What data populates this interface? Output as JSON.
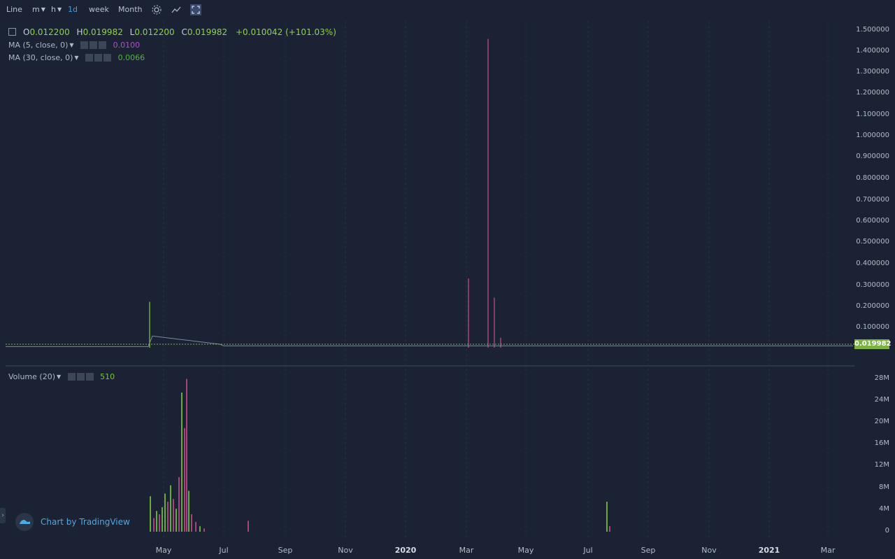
{
  "toolbar": {
    "items": [
      "Line",
      "m",
      "h",
      "1d",
      "week",
      "Month"
    ],
    "active": "1d"
  },
  "legend": {
    "ohlc": {
      "o_label": "O",
      "o": "0.012200",
      "h_label": "H",
      "h": "0.019982",
      "l_label": "L",
      "l": "0.012200",
      "c_label": "C",
      "c": "0.019982",
      "change": "+0.010042 (+101.03%)"
    },
    "ma1": {
      "label": "MA (5, close, 0)",
      "value": "0.0100",
      "color": "#b04fcf"
    },
    "ma2": {
      "label": "MA (30, close, 0)",
      "value": "0.0066",
      "color": "#5cb043"
    },
    "volume": {
      "label": "Volume (20)",
      "value": "510",
      "color": "#7cc241"
    }
  },
  "price_axis": [
    "1.500000",
    "1.400000",
    "1.300000",
    "1.200000",
    "1.100000",
    "1.000000",
    "0.900000",
    "0.800000",
    "0.700000",
    "0.600000",
    "0.500000",
    "0.400000",
    "0.300000",
    "0.200000",
    "0.100000"
  ],
  "current_price": "0.019982",
  "volume_axis": [
    "28M",
    "24M",
    "20M",
    "16M",
    "12M",
    "8M",
    "4M",
    "0"
  ],
  "time_axis": [
    {
      "label": "May",
      "bold": false
    },
    {
      "label": "Jul",
      "bold": false
    },
    {
      "label": "Sep",
      "bold": false
    },
    {
      "label": "Nov",
      "bold": false
    },
    {
      "label": "2020",
      "bold": true
    },
    {
      "label": "Mar",
      "bold": false
    },
    {
      "label": "May",
      "bold": false
    },
    {
      "label": "Jul",
      "bold": false
    },
    {
      "label": "Sep",
      "bold": false
    },
    {
      "label": "Nov",
      "bold": false
    },
    {
      "label": "2021",
      "bold": true
    },
    {
      "label": "Mar",
      "bold": false
    }
  ],
  "watermark": "Chart by TradingView",
  "colors": {
    "up": "#7cc241",
    "down": "#c14a8a",
    "bg": "#1a2233",
    "grid": "#243044",
    "price_tag": "#7bb241"
  },
  "chart_data": {
    "type": "bar",
    "price": {
      "ylim": [
        0,
        1.5
      ],
      "last": 0.019982,
      "spikes_high": [
        0.22,
        0.33,
        1.46,
        0.24,
        0.05
      ]
    },
    "volume": {
      "ylim": [
        0,
        28000000
      ]
    }
  }
}
